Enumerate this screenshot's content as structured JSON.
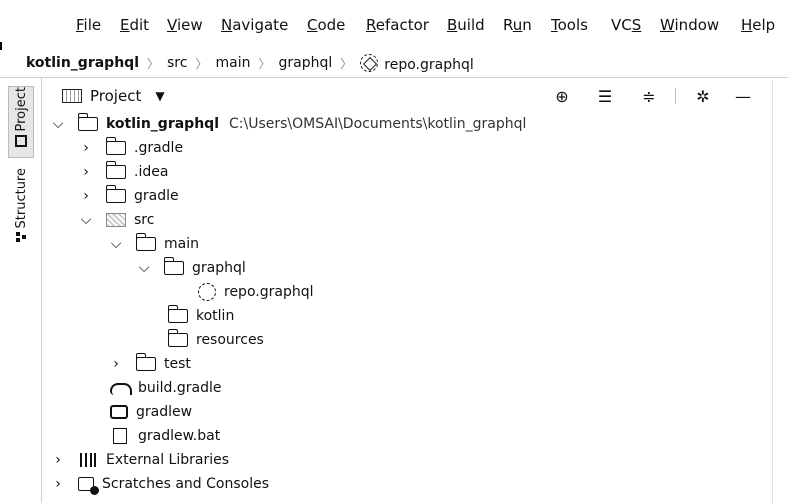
{
  "menubar": {
    "items": [
      {
        "label": "File",
        "mnemonic": "F",
        "rest": "ile"
      },
      {
        "label": "Edit",
        "mnemonic": "E",
        "rest": "dit"
      },
      {
        "label": "View",
        "mnemonic": "V",
        "rest": "iew"
      },
      {
        "label": "Navigate",
        "mnemonic": "N",
        "rest": "avigate"
      },
      {
        "label": "Code",
        "mnemonic": "C",
        "rest": "ode"
      },
      {
        "label": "Refactor",
        "mnemonic": "R",
        "rest": "efactor"
      },
      {
        "label": "Build",
        "mnemonic": "B",
        "rest": "uild"
      },
      {
        "label": "Run",
        "pre": "R",
        "mnemonic": "u",
        "rest": "n"
      },
      {
        "label": "Tools",
        "mnemonic": "T",
        "rest": "ools"
      },
      {
        "label": "VCS",
        "pre": "VC",
        "mnemonic": "S",
        "rest": ""
      },
      {
        "label": "Window",
        "mnemonic": "W",
        "rest": "indow"
      },
      {
        "label": "Help",
        "mnemonic": "H",
        "rest": "elp"
      }
    ]
  },
  "breadcrumb": {
    "items": [
      "kotlin_graphql",
      "src",
      "main",
      "graphql",
      "repo.graphql"
    ]
  },
  "sidebar": {
    "project_label": "Project",
    "structure_label": "Structure"
  },
  "toolbar": {
    "view_label": "Project",
    "icons": [
      "crosshair-icon",
      "expand-all-icon",
      "collapse-all-icon",
      "gear-icon",
      "minimize-icon"
    ]
  },
  "tree": {
    "root": {
      "name": "kotlin_graphql",
      "path": "C:\\Users\\OMSAI\\Documents\\kotlin_graphql"
    },
    "items": [
      {
        "label": ".gradle",
        "icon": "folder-icon",
        "expanded": false
      },
      {
        "label": ".idea",
        "icon": "folder-icon",
        "expanded": false
      },
      {
        "label": "gradle",
        "icon": "folder-icon",
        "expanded": false
      },
      {
        "label": "src",
        "icon": "source-folder-icon",
        "expanded": true
      },
      {
        "label": "main",
        "icon": "folder-icon",
        "expanded": true
      },
      {
        "label": "graphql",
        "icon": "folder-icon",
        "expanded": true
      },
      {
        "label": "repo.graphql",
        "icon": "graphql-file-icon"
      },
      {
        "label": "kotlin",
        "icon": "folder-icon"
      },
      {
        "label": "resources",
        "icon": "folder-icon"
      },
      {
        "label": "test",
        "icon": "folder-icon",
        "expanded": false
      },
      {
        "label": "build.gradle",
        "icon": "gradle-file-icon"
      },
      {
        "label": "gradlew",
        "icon": "terminal-file-icon"
      },
      {
        "label": "gradlew.bat",
        "icon": "batch-file-icon"
      },
      {
        "label": "External Libraries",
        "icon": "libraries-icon",
        "expanded": false
      },
      {
        "label": "Scratches and Consoles",
        "icon": "scratches-icon",
        "expanded": false
      }
    ]
  }
}
